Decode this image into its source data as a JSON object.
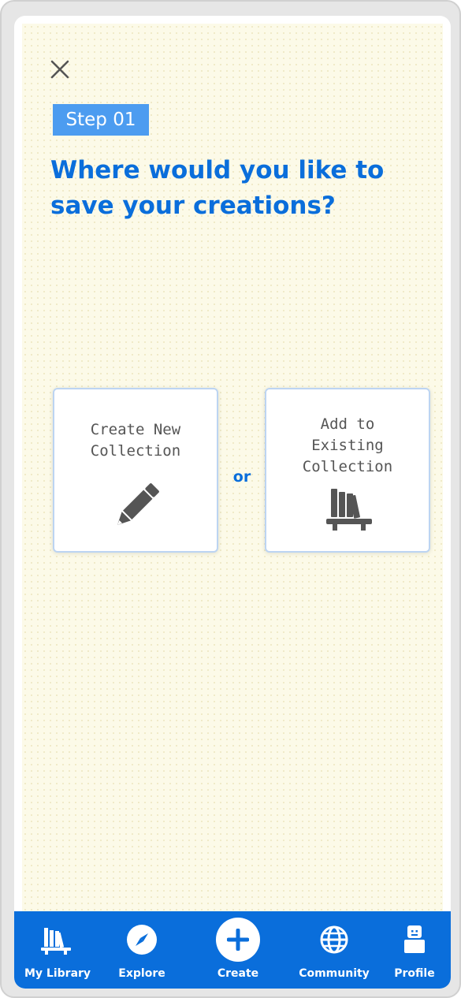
{
  "step": {
    "label": "Step 01"
  },
  "heading": "Where would you like to save your creations?",
  "options": [
    {
      "label": "Create New\nCollection",
      "icon": "pencil-icon"
    },
    {
      "label": "Add to\nExisting\nCollection",
      "icon": "bookshelf-icon"
    }
  ],
  "separator": "or",
  "nav": [
    {
      "label": "My Library",
      "icon": "library-icon"
    },
    {
      "label": "Explore",
      "icon": "compass-icon"
    },
    {
      "label": "Create",
      "icon": "plus-icon"
    },
    {
      "label": "Community",
      "icon": "globe-icon"
    },
    {
      "label": "Profile",
      "icon": "user-block-icon"
    }
  ],
  "colors": {
    "accent": "#0a6edb",
    "badge": "#4c9cf0",
    "background": "#fcfae8",
    "icon_gray": "#555555"
  }
}
